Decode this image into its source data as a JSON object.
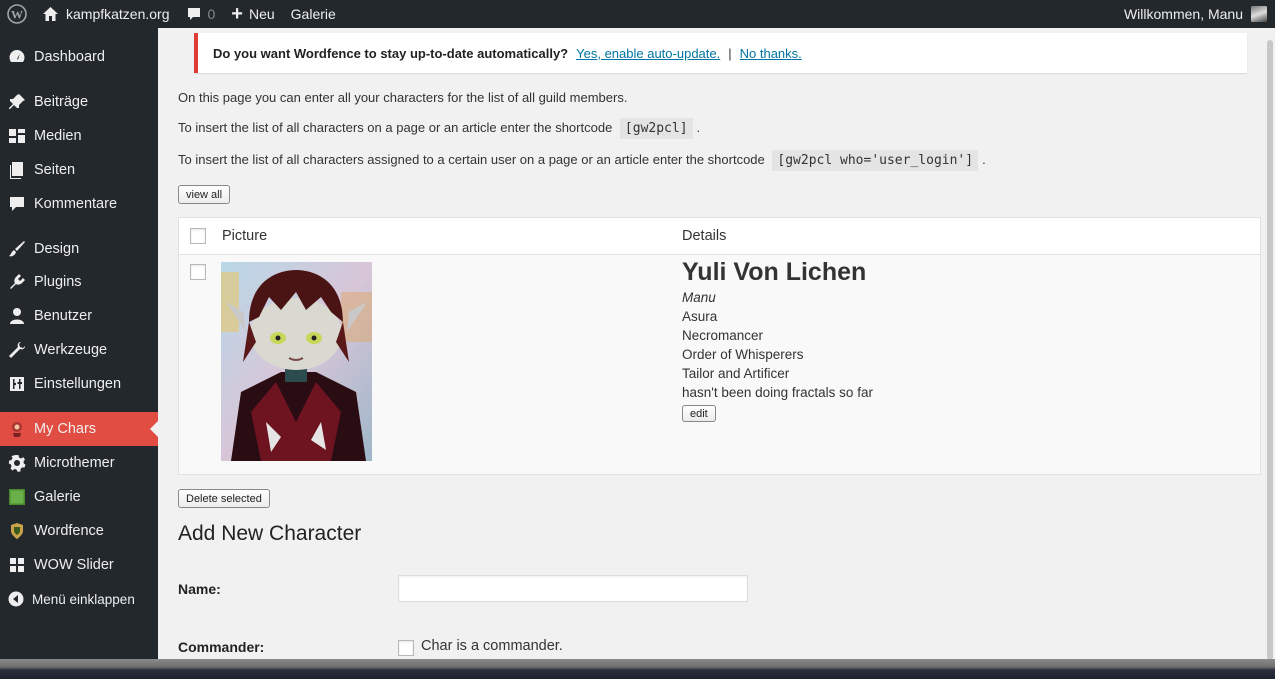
{
  "adminbar": {
    "site_name": "kampfkatzen.org",
    "comment_count": "0",
    "new_label": "Neu",
    "gallery_label": "Galerie",
    "welcome": "Willkommen, Manu"
  },
  "sidebar": {
    "items": [
      {
        "label": "Dashboard",
        "icon": "dashboard-icon"
      },
      {
        "label": "Beiträge",
        "icon": "pin-icon"
      },
      {
        "label": "Medien",
        "icon": "media-icon"
      },
      {
        "label": "Seiten",
        "icon": "pages-icon"
      },
      {
        "label": "Kommentare",
        "icon": "comment-icon"
      },
      {
        "label": "Design",
        "icon": "brush-icon"
      },
      {
        "label": "Plugins",
        "icon": "plugin-icon"
      },
      {
        "label": "Benutzer",
        "icon": "user-icon"
      },
      {
        "label": "Werkzeuge",
        "icon": "wrench-icon"
      },
      {
        "label": "Einstellungen",
        "icon": "settings-icon"
      },
      {
        "label": "My Chars",
        "icon": "char-icon"
      },
      {
        "label": "Microthemer",
        "icon": "gear-icon"
      },
      {
        "label": "Galerie",
        "icon": "gallery-icon"
      },
      {
        "label": "Wordfence",
        "icon": "wordfence-icon"
      },
      {
        "label": "WOW Slider",
        "icon": "grid-icon"
      }
    ],
    "collapse_label": "Menü einklappen",
    "current_color": "#e14d43"
  },
  "notice": {
    "question": "Do you want Wordfence to stay up-to-date automatically?",
    "enable_link": "Yes, enable auto-update.",
    "separator": "|",
    "no_link": "No thanks."
  },
  "intro": {
    "line1": "On this page you can enter all your characters for the list of all guild members.",
    "line2_prefix": "To insert the list of all characters on a page or an article enter the shortcode",
    "line2_code": "[gw2pcl]",
    "line2_suffix": ".",
    "line3_prefix": "To insert the list of all characters assigned to a certain user on a page or an article enter the shortcode",
    "line3_code": "[gw2pcl who='user_login']",
    "line3_suffix": "."
  },
  "buttons": {
    "view_all": "view all",
    "edit": "edit",
    "delete_selected": "Delete selected"
  },
  "table": {
    "col_picture": "Picture",
    "col_details": "Details",
    "rows": [
      {
        "name": "Yuli Von Lichen",
        "owner": "Manu",
        "race": "Asura",
        "profession": "Necromancer",
        "order": "Order of Whisperers",
        "crafting": "Tailor and Artificer",
        "fractals": "hasn't been doing fractals so far"
      }
    ]
  },
  "form": {
    "title": "Add New Character",
    "name_label": "Name:",
    "name_value": "",
    "commander_label": "Commander:",
    "commander_checkbox_label": "Char is a commander."
  }
}
